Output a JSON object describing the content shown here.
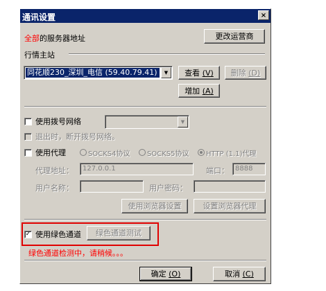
{
  "window": {
    "title": "通讯设置",
    "close_glyph": "×"
  },
  "server": {
    "label_prefix": "全部",
    "label_suffix": "的服务器地址",
    "change_operator_button": "更改运营商",
    "group_label": "行情主站",
    "selected_server": "同花顺230_深圳_电信 (59.40.79.41)",
    "view_button": "查看",
    "view_accel": "(V)",
    "delete_button": "删除",
    "delete_accel": "(D)",
    "add_button": "增加",
    "add_accel": "(A)"
  },
  "dialup": {
    "use_dialup_label": "使用拨号网络",
    "disconnect_on_exit_label": "退出时，断开拨号网络。"
  },
  "proxy": {
    "use_proxy_label": "使用代理",
    "options": [
      "SOCKS4协议",
      "SOCKS5协议",
      "HTTP (1.1)代理"
    ],
    "selected_option": "HTTP (1.1)代理",
    "address_label": "代理地址：",
    "address_value": "127.0.0.1",
    "port_label": "端口：",
    "port_value": "8888",
    "username_label": "用户名称：",
    "password_label": "用户密码：",
    "use_browser_settings_button": "使用浏览器设置",
    "set_browser_proxy_button": "设置浏览器代理"
  },
  "green_channel": {
    "use_label": "使用绿色通道",
    "checked": true,
    "test_button": "绿色通道测试",
    "status_text": "绿色通道检测中，请稍候。。。"
  },
  "footer": {
    "ok_button": "确定",
    "ok_accel": "(O)",
    "cancel_button": "取消",
    "cancel_accel": "(C)"
  },
  "colors": {
    "accent_red": "#ff0000",
    "title_bar": "#0a246a",
    "dialog_face": "#d4d0c8"
  }
}
